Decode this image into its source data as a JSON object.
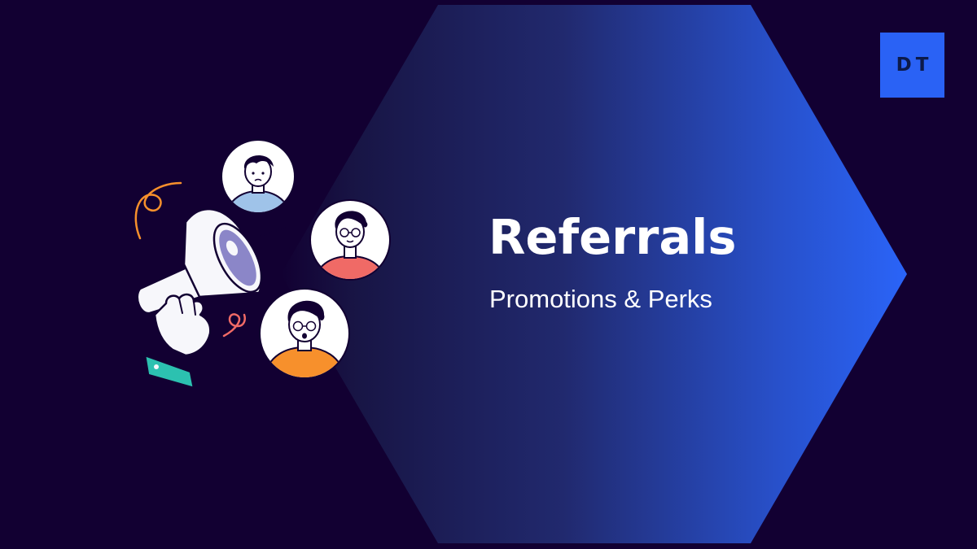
{
  "banner": {
    "title": "Referrals",
    "subtitle": "Promotions & Perks"
  },
  "logo": {
    "text": "DT"
  },
  "illustration": {
    "icons": [
      "megaphone-icon",
      "hand-icon",
      "person-avatar-icon"
    ]
  },
  "colors": {
    "background": "#120032",
    "hexagon_gradient_start": "#1a1240",
    "hexagon_gradient_end": "#2a62f5",
    "logo_badge": "#2a62f5",
    "avatar_shirt_blue": "#9fc3e9",
    "avatar_shirt_red": "#f06a66",
    "avatar_shirt_orange": "#f7902c",
    "cuff_teal": "#2cc1b0"
  }
}
